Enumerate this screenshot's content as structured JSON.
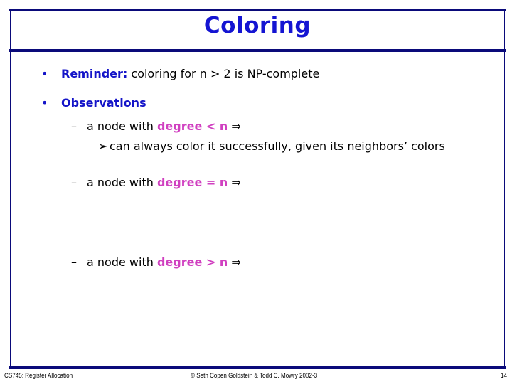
{
  "slide": {
    "title": "Coloring",
    "bullets": [
      {
        "marker": "•",
        "label": "Reminder:",
        "text": " coloring for n > 2 is NP-complete"
      },
      {
        "marker": "•",
        "label": "Observations"
      }
    ],
    "subitems": [
      {
        "marker": "–",
        "prefix": "a node with ",
        "highlight": "degree < n",
        "suffix": " ⇒",
        "detail": {
          "marker": "➢",
          "text": "can always color it successfully, given its neighbors’ colors"
        }
      },
      {
        "marker": "–",
        "prefix": "a node with ",
        "highlight": "degree = n",
        "suffix": " ⇒"
      },
      {
        "marker": "–",
        "prefix": "a node with ",
        "highlight": "degree > n",
        "suffix": " ⇒"
      }
    ]
  },
  "footer": {
    "left": "CS745: Register Allocation",
    "center": "© Seth Copen Goldstein & Todd C. Mowry 2002-3",
    "page_number": "14"
  },
  "colors": {
    "frame": "#0a0a7a",
    "title": "#1414d2",
    "heading": "#1414c8",
    "highlight": "#d040c0"
  }
}
